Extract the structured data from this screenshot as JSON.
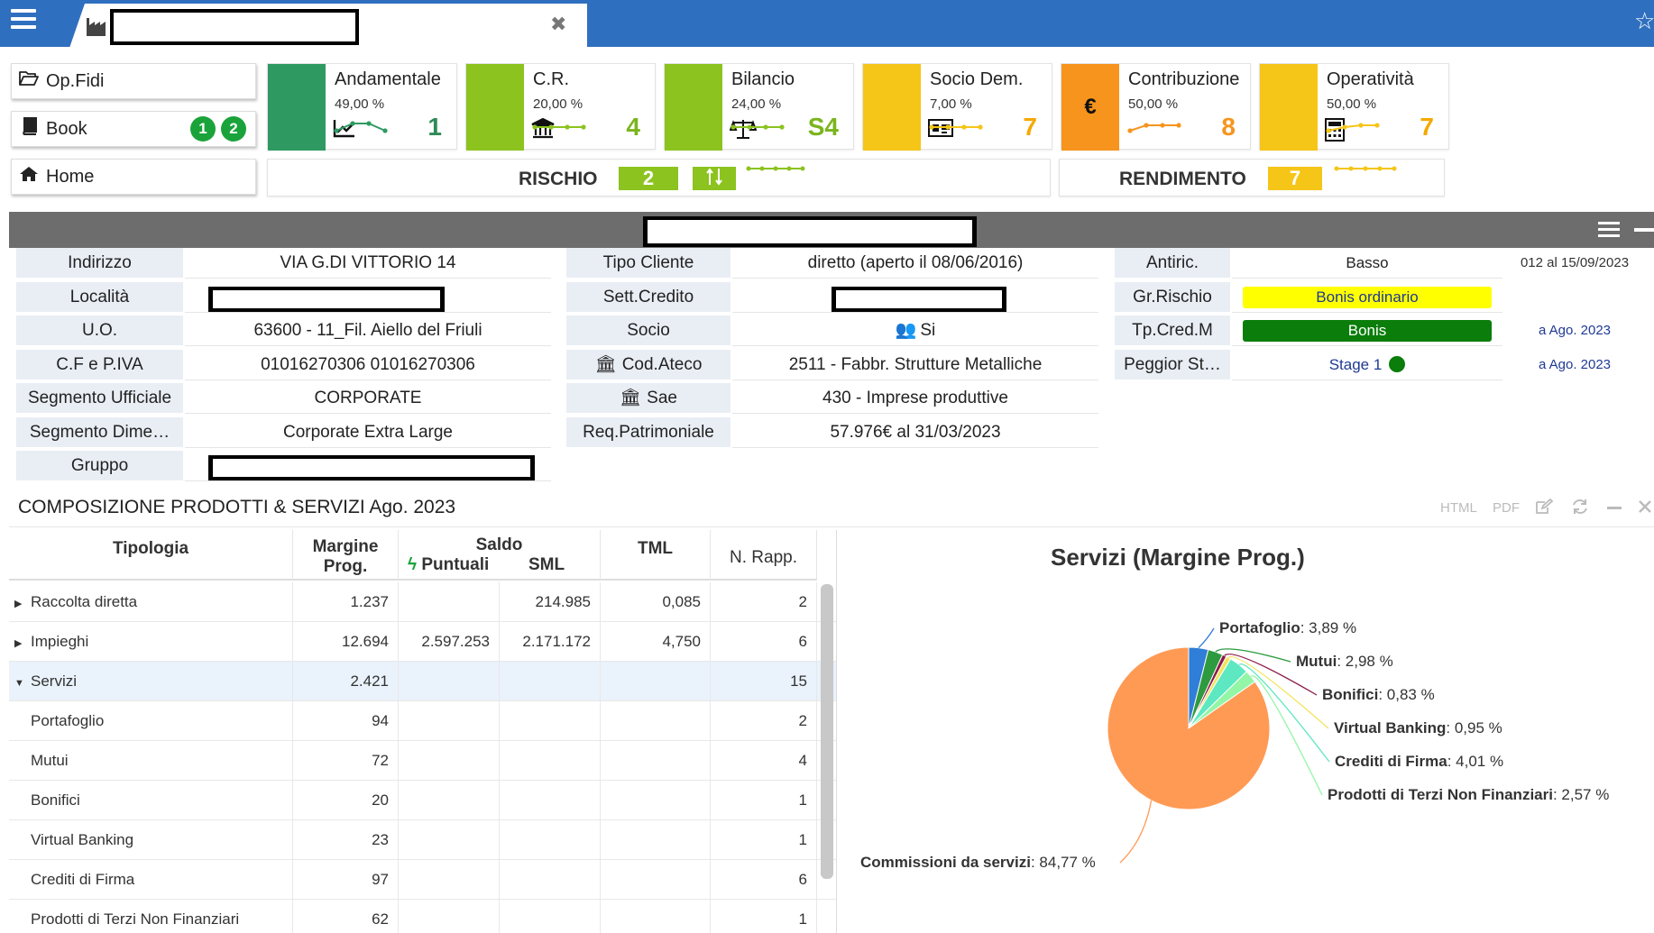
{
  "header": {
    "menu_icon": "hamburger-icon",
    "tab_icon": "factory-icon",
    "tab_close": "✖",
    "star_icon": "star-outline-icon"
  },
  "nav": {
    "opfidi": {
      "label": "Op.Fidi",
      "icon": "folder-open-icon"
    },
    "book": {
      "label": "Book",
      "icon": "book-icon",
      "badges": [
        "1",
        "2"
      ]
    },
    "home": {
      "label": "Home",
      "icon": "home-icon"
    }
  },
  "kpis": [
    {
      "title": "Andamentale",
      "pct": "49,00 %",
      "value": "1",
      "icon": "line-chart-icon",
      "color": "#2e9a62",
      "value_color": "#2e8b57"
    },
    {
      "title": "C.R.",
      "pct": "20,00 %",
      "value": "4",
      "icon": "bank-icon",
      "color": "#8cc31f",
      "value_color": "#7ab51d"
    },
    {
      "title": "Bilancio",
      "pct": "24,00 %",
      "value": "S4",
      "icon": "balance-scale-icon",
      "color": "#8cc31f",
      "value_color": "#7ab51d"
    },
    {
      "title": "Socio Dem.",
      "pct": "7,00 %",
      "value": "7",
      "icon": "id-card-icon",
      "color": "#f5c518",
      "value_color": "#f5a800"
    },
    {
      "title": "Contribuzione",
      "pct": "50,00 %",
      "value": "8",
      "icon": "euro-icon",
      "color": "#f7941d",
      "value_color": "#f7941d"
    },
    {
      "title": "Operatività",
      "pct": "50,00 %",
      "value": "7",
      "icon": "calculator-icon",
      "color": "#f5c518",
      "value_color": "#f5a800"
    }
  ],
  "risk": {
    "label": "RISCHIO",
    "value": "2",
    "badge_color": "#8cc31f",
    "trend_icon": "trend-arrow-icon"
  },
  "yield": {
    "label": "RENDIMENTO",
    "value": "7",
    "badge_color": "#f5c518"
  },
  "info_left": [
    {
      "label": "Indirizzo",
      "value": "VIA G.DI VITTORIO 14"
    },
    {
      "label": "Località",
      "value": ""
    },
    {
      "label": "U.O.",
      "value": "63600 - 11_Fil. Aiello del Friuli"
    },
    {
      "label": "C.F e P.IVA",
      "value": "01016270306 01016270306"
    },
    {
      "label": "Segmento Ufficiale",
      "value": "CORPORATE"
    },
    {
      "label": "Segmento Dime…",
      "value": "Corporate Extra Large"
    },
    {
      "label": "Gruppo",
      "value": ""
    }
  ],
  "info_mid": [
    {
      "label": "Tipo Cliente",
      "value": "diretto (aperto il 08/06/2016)"
    },
    {
      "label": "Sett.Credito",
      "value": ""
    },
    {
      "label": "Socio",
      "value": "Si",
      "value_icon": "users-icon"
    },
    {
      "label": "Cod.Ateco",
      "label_icon": "bank-icon",
      "value": "2511 - Fabbr. Strutture Metalliche"
    },
    {
      "label": "Sae",
      "label_icon": "bank-icon",
      "value": "430 - Imprese produttive"
    },
    {
      "label": "Req.Patrimoniale",
      "value": "57.976€ al 31/03/2023"
    }
  ],
  "info_right": [
    {
      "label": "Antiric.",
      "value": "Basso",
      "note": "012 al 15/09/2023"
    },
    {
      "label": "Gr.Rischio",
      "value": "Bonis ordinario",
      "bg": "#ffff00",
      "fg": "#1f3a93"
    },
    {
      "label": "Tp.Cred.M",
      "value": "Bonis",
      "bg": "#0a7d0a",
      "fg": "#ffffff",
      "note": "a Ago. 2023"
    },
    {
      "label": "Peggior St…",
      "value": "Stage 1",
      "dot": "#0a7d0a",
      "fg": "#1f3a93",
      "note": "a Ago. 2023"
    }
  ],
  "composition": {
    "title": "COMPOSIZIONE PRODOTTI & SERVIZI Ago. 2023",
    "toolbar": [
      "HTML",
      "PDF"
    ],
    "columns": {
      "tipologia": "Tipologia",
      "margine": "Margine Prog.",
      "saldo": "Saldo",
      "puntuali": "Puntuali",
      "sml": "SML",
      "tml": "TML",
      "nrapp": "N. Rapp."
    },
    "rows": [
      {
        "tipologia": "Raccolta diretta",
        "expand": "▶",
        "margine": "1.237",
        "puntuali": "",
        "sml": "214.985",
        "tml": "0,085",
        "nrapp": "2"
      },
      {
        "tipologia": "Impieghi",
        "expand": "▶",
        "margine": "12.694",
        "puntuali": "2.597.253",
        "sml": "2.171.172",
        "tml": "4,750",
        "nrapp": "6"
      },
      {
        "tipologia": "Servizi",
        "expand": "▼",
        "margine": "2.421",
        "puntuali": "",
        "sml": "",
        "tml": "",
        "nrapp": "15"
      },
      {
        "tipologia": "Portafoglio",
        "expand": "",
        "margine": "94",
        "puntuali": "",
        "sml": "",
        "tml": "",
        "nrapp": "2"
      },
      {
        "tipologia": "Mutui",
        "expand": "",
        "margine": "72",
        "puntuali": "",
        "sml": "",
        "tml": "",
        "nrapp": "4"
      },
      {
        "tipologia": "Bonifici",
        "expand": "",
        "margine": "20",
        "puntuali": "",
        "sml": "",
        "tml": "",
        "nrapp": "1"
      },
      {
        "tipologia": "Virtual Banking",
        "expand": "",
        "margine": "23",
        "puntuali": "",
        "sml": "",
        "tml": "",
        "nrapp": "1"
      },
      {
        "tipologia": "Crediti di Firma",
        "expand": "",
        "margine": "97",
        "puntuali": "",
        "sml": "",
        "tml": "",
        "nrapp": "6"
      },
      {
        "tipologia": "Prodotti di Terzi Non Finanziari",
        "expand": "",
        "margine": "62",
        "puntuali": "",
        "sml": "",
        "tml": "",
        "nrapp": "1"
      }
    ]
  },
  "chart_data": {
    "type": "pie",
    "title": "Servizi (Margine Prog.)",
    "slices": [
      {
        "name": "Portafoglio",
        "value": 3.89,
        "label": "3,89 %",
        "color": "#2f7ed8"
      },
      {
        "name": "Mutui",
        "value": 2.98,
        "label": "2,98 %",
        "color": "#2e9a3f"
      },
      {
        "name": "Bonifici",
        "value": 0.83,
        "label": "0,83 %",
        "color": "#8b1a4a"
      },
      {
        "name": "Virtual Banking",
        "value": 0.95,
        "label": "0,95 %",
        "color": "#f2e35d"
      },
      {
        "name": "Crediti di Firma",
        "value": 4.01,
        "label": "4,01 %",
        "color": "#5de8c1"
      },
      {
        "name": "Prodotti di Terzi Non Finanziari",
        "value": 2.57,
        "label": "2,57 %",
        "color": "#93f5a6"
      },
      {
        "name": "Commissioni da servizi",
        "value": 84.77,
        "label": "84,77 %",
        "color": "#ff9a55"
      }
    ]
  }
}
